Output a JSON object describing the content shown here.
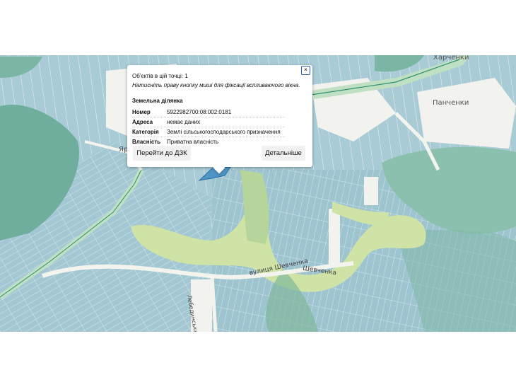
{
  "map": {
    "place_labels": {
      "top_right": "Харченки",
      "right": "Панченки",
      "left": "Яро",
      "road_center": "вулиця Шевченка",
      "road_center_2": "Шевченка",
      "road_vertical": "Лебединська місь"
    }
  },
  "popup": {
    "objects_text": "Об'єктів в цій точці: 1",
    "hint": "Натисніть праву кнопку миші для фіксації вспливаючого вікна.",
    "close_label": "×",
    "section_title": "Земельна ділянка",
    "fields": [
      {
        "key": "Номер",
        "value": "5922982700:08:002:0181"
      },
      {
        "key": "Адреса",
        "value": "немає даних"
      },
      {
        "key": "Категорія",
        "value": "Землі сільськогосподарського призначення"
      },
      {
        "key": "Власність",
        "value": "Приватна власність"
      }
    ],
    "btn_dzk": "Перейти до ДЗК",
    "btn_details": "Детальніше"
  },
  "colors": {
    "parcel": "#a8cbd6",
    "parcel_border": "#ffffff",
    "forest": "#6fae9c",
    "meadow": "#cfe3a6",
    "selected": "#4f95c3",
    "road": "#f4f4ef",
    "road_green": "#bfe0c2"
  }
}
